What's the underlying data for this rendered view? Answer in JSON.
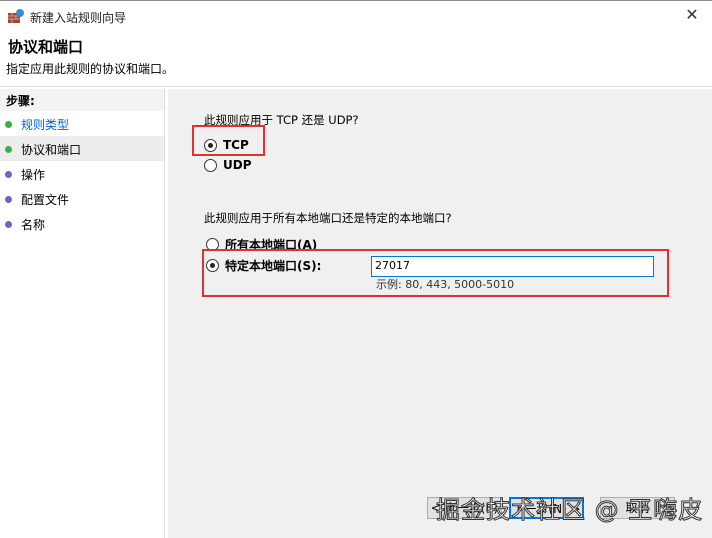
{
  "window": {
    "title": "新建入站规则向导",
    "close": "✕"
  },
  "header": {
    "title": "协议和端口",
    "subtitle": "指定应用此规则的协议和端口。"
  },
  "sidebar": {
    "heading": "步骤:",
    "items": [
      {
        "label": "规则类型",
        "dot": "#3cb040"
      },
      {
        "label": "协议和端口",
        "dot": "#3cb040"
      },
      {
        "label": "操作",
        "dot": "#7060c8"
      },
      {
        "label": "配置文件",
        "dot": "#7060c8"
      },
      {
        "label": "名称",
        "dot": "#7060c8"
      }
    ]
  },
  "main": {
    "protocol_question": "此规则应用于 TCP 还是 UDP?",
    "tcp": "TCP",
    "udp": "UDP",
    "port_question": "此规则应用于所有本地端口还是特定的本地端口?",
    "all_ports": "所有本地端口(A)",
    "specific_ports": "特定本地端口(S):",
    "port_value": "27017",
    "example": "示例: 80, 443, 5000-5010"
  },
  "buttons": {
    "back": "< 上一步(B)",
    "next": "下一步(N) >",
    "cancel": "取消"
  },
  "watermark": "掘金技术社区 @ 王嗨皮"
}
